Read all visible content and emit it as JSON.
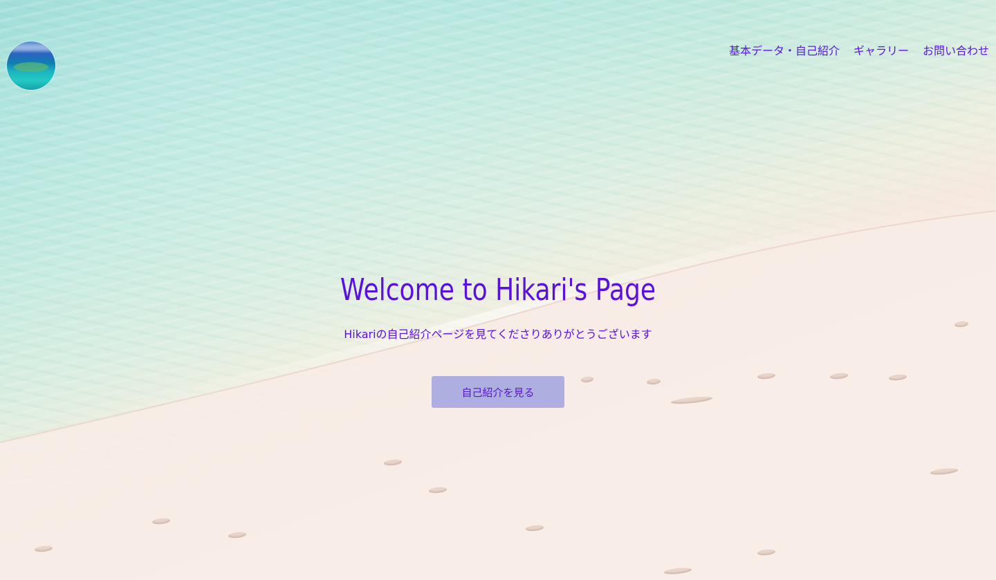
{
  "site": {
    "logo_alt": "ocean-reef-logo"
  },
  "nav": {
    "items": [
      {
        "label": "基本データ・自己紹介"
      },
      {
        "label": "ギャラリー"
      },
      {
        "label": "お問い合わせ"
      }
    ],
    "link_color": "#5a17e0"
  },
  "hero": {
    "title": "Welcome to Hikari's Page",
    "subtitle": "Hikariの自己紹介ページを見てくださりありがとうございます",
    "cta_label": "自己紹介を見る",
    "text_color": "#5a10e0",
    "button_color": "#aeaee0"
  },
  "background": {
    "scene": "beach-shoreline",
    "water_color": "#9fded6",
    "sand_color": "#f8eee8"
  }
}
